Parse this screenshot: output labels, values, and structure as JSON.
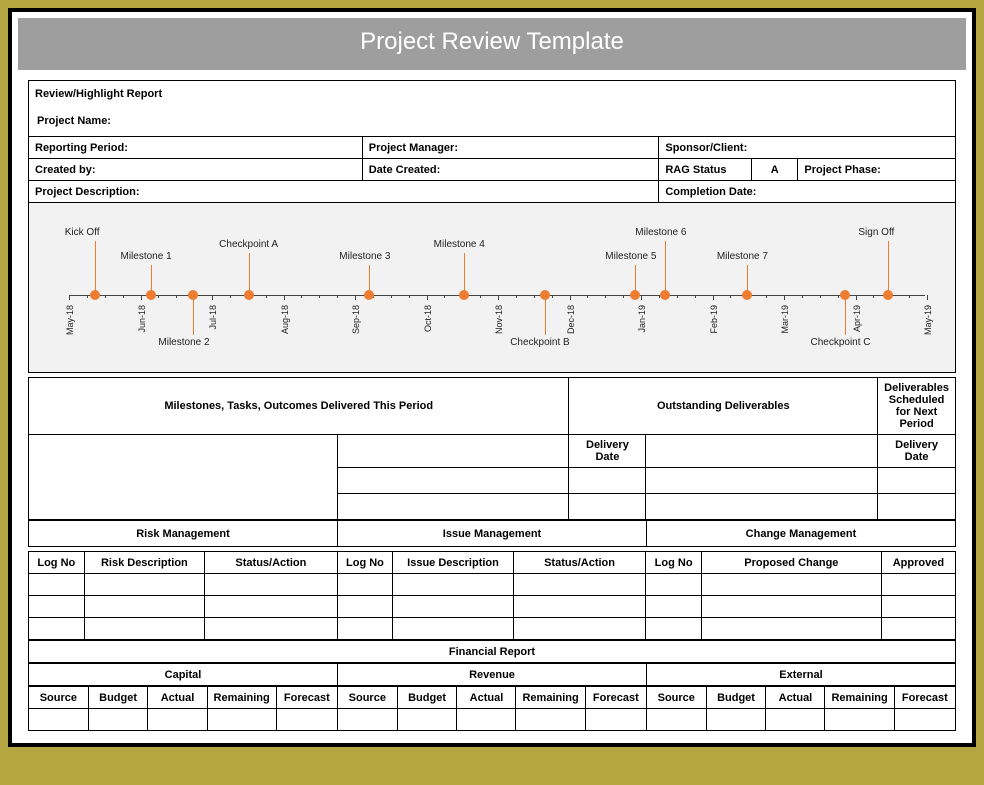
{
  "title": "Project Review Template",
  "header": {
    "report_title": "Review/Highlight Report",
    "project_name_label": "Project Name:",
    "reporting_period_label": "Reporting Period:",
    "project_manager_label": "Project Manager:",
    "sponsor_client_label": "Sponsor/Client:",
    "created_by_label": "Created by:",
    "date_created_label": "Date Created:",
    "rag_status_label": "RAG Status",
    "rag_status_value": "A",
    "project_phase_label": "Project Phase:",
    "project_description_label": "Project Description:",
    "completion_date_label": "Completion Date:"
  },
  "timeline": {
    "ticks": [
      "May-18",
      "Jun-18",
      "Jul-18",
      "Aug-18",
      "Sep-18",
      "Oct-18",
      "Nov-18",
      "Dec-18",
      "Jan-19",
      "Feb-19",
      "Mar-19",
      "Apr-19",
      "May-19"
    ],
    "milestones": [
      {
        "label": "Kick Off",
        "pos": 0.03,
        "side": "up",
        "len": 54
      },
      {
        "label": "Milestone 1",
        "pos": 0.095,
        "side": "up",
        "len": 30
      },
      {
        "label": "Milestone 2",
        "pos": 0.145,
        "side": "down",
        "len": 40
      },
      {
        "label": "Checkpoint A",
        "pos": 0.21,
        "side": "up",
        "len": 42
      },
      {
        "label": "Milestone 3",
        "pos": 0.35,
        "side": "up",
        "len": 30
      },
      {
        "label": "Milestone 4",
        "pos": 0.46,
        "side": "up",
        "len": 42
      },
      {
        "label": "Checkpoint B",
        "pos": 0.555,
        "side": "down",
        "len": 40
      },
      {
        "label": "Milestone 5",
        "pos": 0.66,
        "side": "up",
        "len": 30
      },
      {
        "label": "Milestone 6",
        "pos": 0.695,
        "side": "up",
        "len": 54
      },
      {
        "label": "Milestone 7",
        "pos": 0.79,
        "side": "up",
        "len": 30
      },
      {
        "label": "Checkpoint C",
        "pos": 0.905,
        "side": "down",
        "len": 40
      },
      {
        "label": "Sign Off",
        "pos": 0.955,
        "side": "up",
        "len": 54
      }
    ]
  },
  "deliverables": {
    "this_period": "Milestones, Tasks, Outcomes Delivered This Period",
    "outstanding": "Outstanding Deliverables",
    "next_period": "Deliverables Scheduled for Next Period",
    "delivery_date": "Delivery Date"
  },
  "management": {
    "risk": "Risk Management",
    "issue": "Issue Management",
    "change": "Change Management",
    "log_no": "Log No",
    "risk_desc": "Risk Description",
    "status_action": "Status/Action",
    "issue_desc": "Issue Description",
    "proposed_change": "Proposed Change",
    "approved": "Approved"
  },
  "financial": {
    "title": "Financial Report",
    "capital": "Capital",
    "revenue": "Revenue",
    "external": "External",
    "source": "Source",
    "budget": "Budget",
    "actual": "Actual",
    "remaining": "Remaining",
    "forecast": "Forecast"
  }
}
